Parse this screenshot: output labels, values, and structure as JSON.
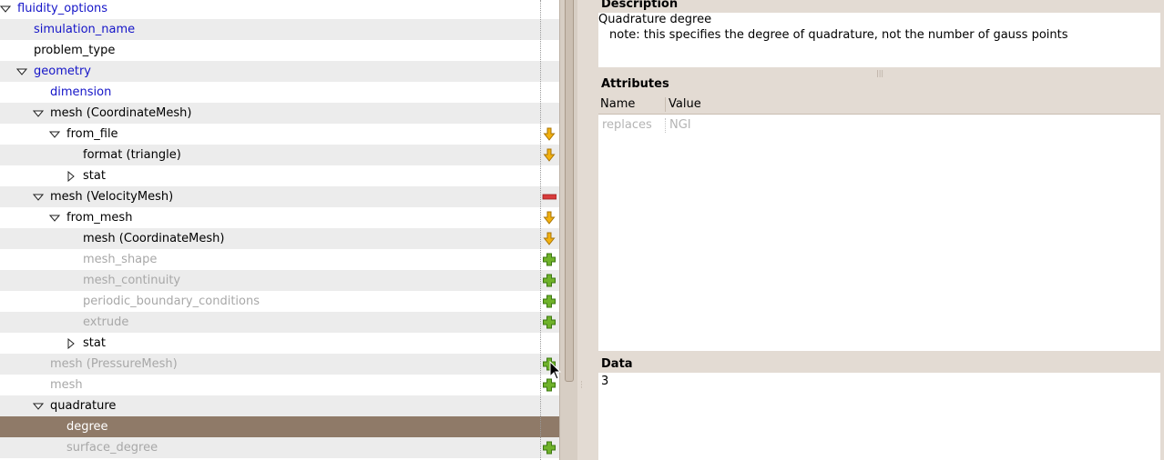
{
  "tree": [
    {
      "label": "fluidity_options",
      "indent": 0,
      "expander": "open",
      "style": "blue",
      "alt": false,
      "action": null
    },
    {
      "label": "simulation_name",
      "indent": 1,
      "expander": null,
      "style": "blue",
      "alt": true,
      "action": null
    },
    {
      "label": "problem_type",
      "indent": 1,
      "expander": null,
      "style": "normal",
      "alt": false,
      "action": null
    },
    {
      "label": "geometry",
      "indent": 1,
      "expander": "open",
      "style": "blue",
      "alt": true,
      "action": null
    },
    {
      "label": "dimension",
      "indent": 2,
      "expander": null,
      "style": "blue",
      "alt": false,
      "action": null
    },
    {
      "label": "mesh (CoordinateMesh)",
      "indent": 2,
      "expander": "open",
      "style": "normal",
      "alt": true,
      "action": null
    },
    {
      "label": "from_file",
      "indent": 3,
      "expander": "open",
      "style": "normal",
      "alt": false,
      "action": "choice"
    },
    {
      "label": "format (triangle)",
      "indent": 4,
      "expander": null,
      "style": "normal",
      "alt": true,
      "action": "choice"
    },
    {
      "label": "stat",
      "indent": 4,
      "expander": "closed",
      "style": "normal",
      "alt": false,
      "action": null
    },
    {
      "label": "mesh (VelocityMesh)",
      "indent": 2,
      "expander": "open",
      "style": "normal",
      "alt": true,
      "action": "remove"
    },
    {
      "label": "from_mesh",
      "indent": 3,
      "expander": "open",
      "style": "normal",
      "alt": false,
      "action": "choice"
    },
    {
      "label": "mesh (CoordinateMesh)",
      "indent": 4,
      "expander": null,
      "style": "normal",
      "alt": true,
      "action": "choice"
    },
    {
      "label": "mesh_shape",
      "indent": 4,
      "expander": null,
      "style": "grey",
      "alt": false,
      "action": "add"
    },
    {
      "label": "mesh_continuity",
      "indent": 4,
      "expander": null,
      "style": "grey",
      "alt": true,
      "action": "add"
    },
    {
      "label": "periodic_boundary_conditions",
      "indent": 4,
      "expander": null,
      "style": "grey",
      "alt": false,
      "action": "add"
    },
    {
      "label": "extrude",
      "indent": 4,
      "expander": null,
      "style": "grey",
      "alt": true,
      "action": "add"
    },
    {
      "label": "stat",
      "indent": 4,
      "expander": "closed",
      "style": "normal",
      "alt": false,
      "action": null
    },
    {
      "label": "mesh (PressureMesh)",
      "indent": 2,
      "expander": null,
      "style": "grey",
      "alt": true,
      "action": "add"
    },
    {
      "label": "mesh",
      "indent": 2,
      "expander": null,
      "style": "grey",
      "alt": false,
      "action": "add"
    },
    {
      "label": "quadrature",
      "indent": 2,
      "expander": "open",
      "style": "normal",
      "alt": true,
      "action": null
    },
    {
      "label": "degree",
      "indent": 3,
      "expander": null,
      "style": "selected",
      "alt": false,
      "action": null
    },
    {
      "label": "surface_degree",
      "indent": 3,
      "expander": null,
      "style": "grey",
      "alt": true,
      "action": "add"
    }
  ],
  "description": {
    "heading": "Description",
    "title": "Quadrature degree",
    "note": "note: this specifies the degree of quadrature, not the number of gauss points"
  },
  "attributes": {
    "heading": "Attributes",
    "col_name": "Name",
    "col_value": "Value",
    "rows": [
      {
        "name": "replaces",
        "value": "NGI"
      }
    ]
  },
  "data": {
    "heading": "Data",
    "value": "3"
  },
  "colors": {
    "selected_row": "#8f7a68",
    "alt_row": "#ececec",
    "blue_text": "#1515c8",
    "grey_text": "#a8a8a8",
    "panel_bg": "#e3dbd3"
  }
}
